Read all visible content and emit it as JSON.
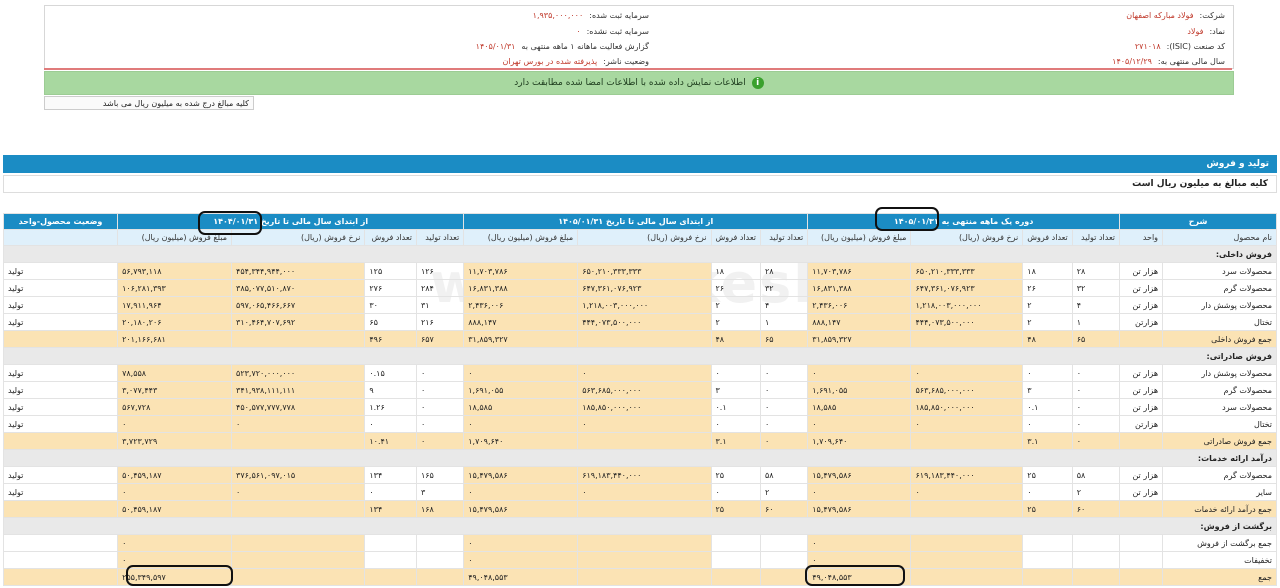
{
  "header": {
    "company_label": "شرکت:",
    "company_value": "فولاد مبارکه اصفهان",
    "symbol_label": "نماد:",
    "symbol_value": "فولاد",
    "isic_label": "کد صنعت (ISIC):",
    "isic_value": "۲۷۱۰۱۸",
    "fiscal_label": "سال مالی منتهی به:",
    "fiscal_value": "۱۴۰۵/۱۲/۲۹",
    "capital_reg_label": "سرمایه ثبت شده:",
    "capital_reg_value": "۱,۹۳۵,۰۰۰,۰۰۰",
    "capital_unreg_label": "سرمایه ثبت نشده:",
    "capital_unreg_value": "۰",
    "report_label": "گزارش فعالیت ماهانه ۱ ماهه منتهی به",
    "report_value": "۱۴۰۵/۰۱/۳۱",
    "status_label": "وضعیت ناشر:",
    "status_value": "پذیرفته شده در بورس تهران"
  },
  "notice": {
    "icon": "info-icon",
    "text": "اطلاعات نمایش داده شده با اطلاعات امضا شده مطابقت دارد"
  },
  "unit_note": "کلیه مبالغ درج شده به میلیون ریال می باشد",
  "section": {
    "title": "تولید و فروش",
    "note": "کلیه مبالغ به میلیون ریال است"
  },
  "watermark": "www.Vakesh3.com",
  "table": {
    "groups": {
      "desc": "شرح",
      "period": "دوره یک ماهه منتهی به ۱۴۰۵/۰۱/۳۱",
      "ytd": "از ابتدای سال مالی تا تاریخ ۱۴۰۵/۰۱/۳۱",
      "prev": "از ابتدای سال مالی تا تاریخ ۱۴۰۴/۰۱/۳۱",
      "status": "وضعیت محصول-واحد"
    },
    "cols": {
      "product": "نام محصول",
      "unit": "واحد",
      "prod_qty": "تعداد تولید",
      "sales_qty": "تعداد فروش",
      "rate": "نرخ فروش (ریال)",
      "amount": "مبلغ فروش (میلیون ریال)"
    },
    "rows": [
      {
        "type": "cat",
        "label": "فروش داخلی:"
      },
      {
        "type": "row",
        "c": [
          "محصولات سرد",
          "هزار تن",
          "۲۸",
          "۱۸",
          "۶۵۰,۲۱۰,۳۳۳,۳۳۳",
          "۱۱,۷۰۳,۷۸۶",
          "۲۸",
          "۱۸",
          "۶۵۰,۲۱۰,۳۳۳,۳۳۳",
          "۱۱,۷۰۳,۷۸۶",
          "۱۲۶",
          "۱۲۵",
          "۴۵۴,۳۴۴,۹۴۴,۰۰۰",
          "۵۶,۷۹۳,۱۱۸",
          "تولید"
        ]
      },
      {
        "type": "row",
        "c": [
          "محصولات گرم",
          "هزار تن",
          "۳۲",
          "۲۶",
          "۶۴۷,۳۶۱,۰۷۶,۹۲۳",
          "۱۶,۸۳۱,۳۸۸",
          "۳۲",
          "۲۶",
          "۶۴۷,۳۶۱,۰۷۶,۹۲۳",
          "۱۶,۸۳۱,۳۸۸",
          "۲۸۴",
          "۲۷۶",
          "۳۸۵,۰۷۷,۵۱۰,۸۷۰",
          "۱۰۶,۲۸۱,۳۹۳",
          "تولید"
        ]
      },
      {
        "type": "row",
        "c": [
          "محصولات پوشش دار",
          "هزار تن",
          "۴",
          "۲",
          "۱,۲۱۸,۰۰۳,۰۰۰,۰۰۰",
          "۲,۴۳۶,۰۰۶",
          "۴",
          "۲",
          "۱,۲۱۸,۰۰۳,۰۰۰,۰۰۰",
          "۲,۴۳۶,۰۰۶",
          "۳۱",
          "۳۰",
          "۵۹۷,۰۶۵,۴۶۶,۶۶۷",
          "۱۷,۹۱۱,۹۶۴",
          "تولید"
        ]
      },
      {
        "type": "row",
        "c": [
          "تختال",
          "هزارتن",
          "۱",
          "۲",
          "۴۴۴,۰۷۳,۵۰۰,۰۰۰",
          "۸۸۸,۱۴۷",
          "۱",
          "۲",
          "۴۴۴,۰۷۳,۵۰۰,۰۰۰",
          "۸۸۸,۱۴۷",
          "۲۱۶",
          "۶۵",
          "۳۱۰,۴۶۴,۷۰۷,۶۹۲",
          "۲۰,۱۸۰,۲۰۶",
          "تولید"
        ]
      },
      {
        "type": "tot",
        "c": [
          "جمع فروش داخلی",
          "",
          "۶۵",
          "۴۸",
          "",
          "۳۱,۸۵۹,۳۲۷",
          "۶۵",
          "۴۸",
          "",
          "۳۱,۸۵۹,۳۲۷",
          "۶۵۷",
          "۴۹۶",
          "",
          "۲۰۱,۱۶۶,۶۸۱",
          ""
        ]
      },
      {
        "type": "cat",
        "label": "فروش صادراتی:"
      },
      {
        "type": "row",
        "c": [
          "محصولات پوشش دار",
          "هزار تن",
          "۰",
          "۰",
          "۰",
          "۰",
          "۰",
          "۰",
          "۰",
          "۰",
          "۰",
          "۰.۱۵",
          "۵۲۳,۷۲۰,۰۰۰,۰۰۰",
          "۷۸,۵۵۸",
          "تولید"
        ]
      },
      {
        "type": "row",
        "c": [
          "محصولات گرم",
          "هزار تن",
          "۰",
          "۳",
          "۵۶۳,۶۸۵,۰۰۰,۰۰۰",
          "۱,۶۹۱,۰۵۵",
          "۰",
          "۳",
          "۵۶۳,۶۸۵,۰۰۰,۰۰۰",
          "۱,۶۹۱,۰۵۵",
          "۰",
          "۹",
          "۳۴۱,۹۳۸,۱۱۱,۱۱۱",
          "۳,۰۷۷,۴۴۳",
          "تولید"
        ]
      },
      {
        "type": "row",
        "c": [
          "محصولات سرد",
          "هزار تن",
          "۰",
          "۰.۱",
          "۱۸۵,۸۵۰,۰۰۰,۰۰۰",
          "۱۸,۵۸۵",
          "۰",
          "۰.۱",
          "۱۸۵,۸۵۰,۰۰۰,۰۰۰",
          "۱۸,۵۸۵",
          "۰",
          "۱.۲۶",
          "۴۵۰,۵۷۷,۷۷۷,۷۷۸",
          "۵۶۷,۷۲۸",
          "تولید"
        ]
      },
      {
        "type": "row",
        "c": [
          "تختال",
          "هزارتن",
          "۰",
          "۰",
          "۰",
          "۰",
          "۰",
          "۰",
          "۰",
          "۰",
          "۰",
          "۰",
          "۰",
          "۰",
          "تولید"
        ]
      },
      {
        "type": "tot",
        "c": [
          "جمع فروش صادراتی",
          "",
          "۰",
          "۳.۱",
          "",
          "۱,۷۰۹,۶۴۰",
          "۰",
          "۳.۱",
          "",
          "۱,۷۰۹,۶۴۰",
          "۰",
          "۱۰.۴۱",
          "",
          "۳,۷۲۳,۷۲۹",
          ""
        ]
      },
      {
        "type": "cat",
        "label": "درآمد ارائه خدمات:"
      },
      {
        "type": "row",
        "c": [
          "محصولات گرم",
          "هزار تن",
          "۵۸",
          "۲۵",
          "۶۱۹,۱۸۳,۴۴۰,۰۰۰",
          "۱۵,۴۷۹,۵۸۶",
          "۵۸",
          "۲۵",
          "۶۱۹,۱۸۳,۴۴۰,۰۰۰",
          "۱۵,۴۷۹,۵۸۶",
          "۱۶۵",
          "۱۳۴",
          "۳۷۶,۵۶۱,۰۹۷,۰۱۵",
          "۵۰,۴۵۹,۱۸۷",
          "تولید"
        ]
      },
      {
        "type": "row",
        "c": [
          "سایر",
          "هزار تن",
          "۲",
          "۰",
          "۰",
          "۰",
          "۲",
          "۰",
          "۰",
          "۰",
          "۳",
          "۰",
          "۰",
          "۰",
          "تولید"
        ]
      },
      {
        "type": "tot",
        "c": [
          "جمع درآمد ارائه خدمات",
          "",
          "۶۰",
          "۲۵",
          "",
          "۱۵,۴۷۹,۵۸۶",
          "۶۰",
          "۲۵",
          "",
          "۱۵,۴۷۹,۵۸۶",
          "۱۶۸",
          "۱۳۴",
          "",
          "۵۰,۴۵۹,۱۸۷",
          ""
        ]
      },
      {
        "type": "cat",
        "label": "برگشت از فروش:"
      },
      {
        "type": "row",
        "c": [
          "جمع برگشت از فروش",
          "",
          "",
          "",
          "",
          "۰",
          "",
          "",
          "",
          "۰",
          "",
          "",
          "",
          "۰",
          ""
        ]
      },
      {
        "type": "row",
        "c": [
          "تخفیفات",
          "",
          "",
          "",
          "",
          "۰",
          "",
          "",
          "",
          "۰",
          "",
          "",
          "",
          "۰",
          ""
        ]
      },
      {
        "type": "tot",
        "c": [
          "جمع",
          "",
          "",
          "",
          "",
          "۴۹,۰۴۸,۵۵۳",
          "",
          "",
          "",
          "۴۹,۰۴۸,۵۵۳",
          "",
          "",
          "",
          "۲۵۵,۳۴۹,۵۹۷",
          ""
        ]
      }
    ]
  }
}
